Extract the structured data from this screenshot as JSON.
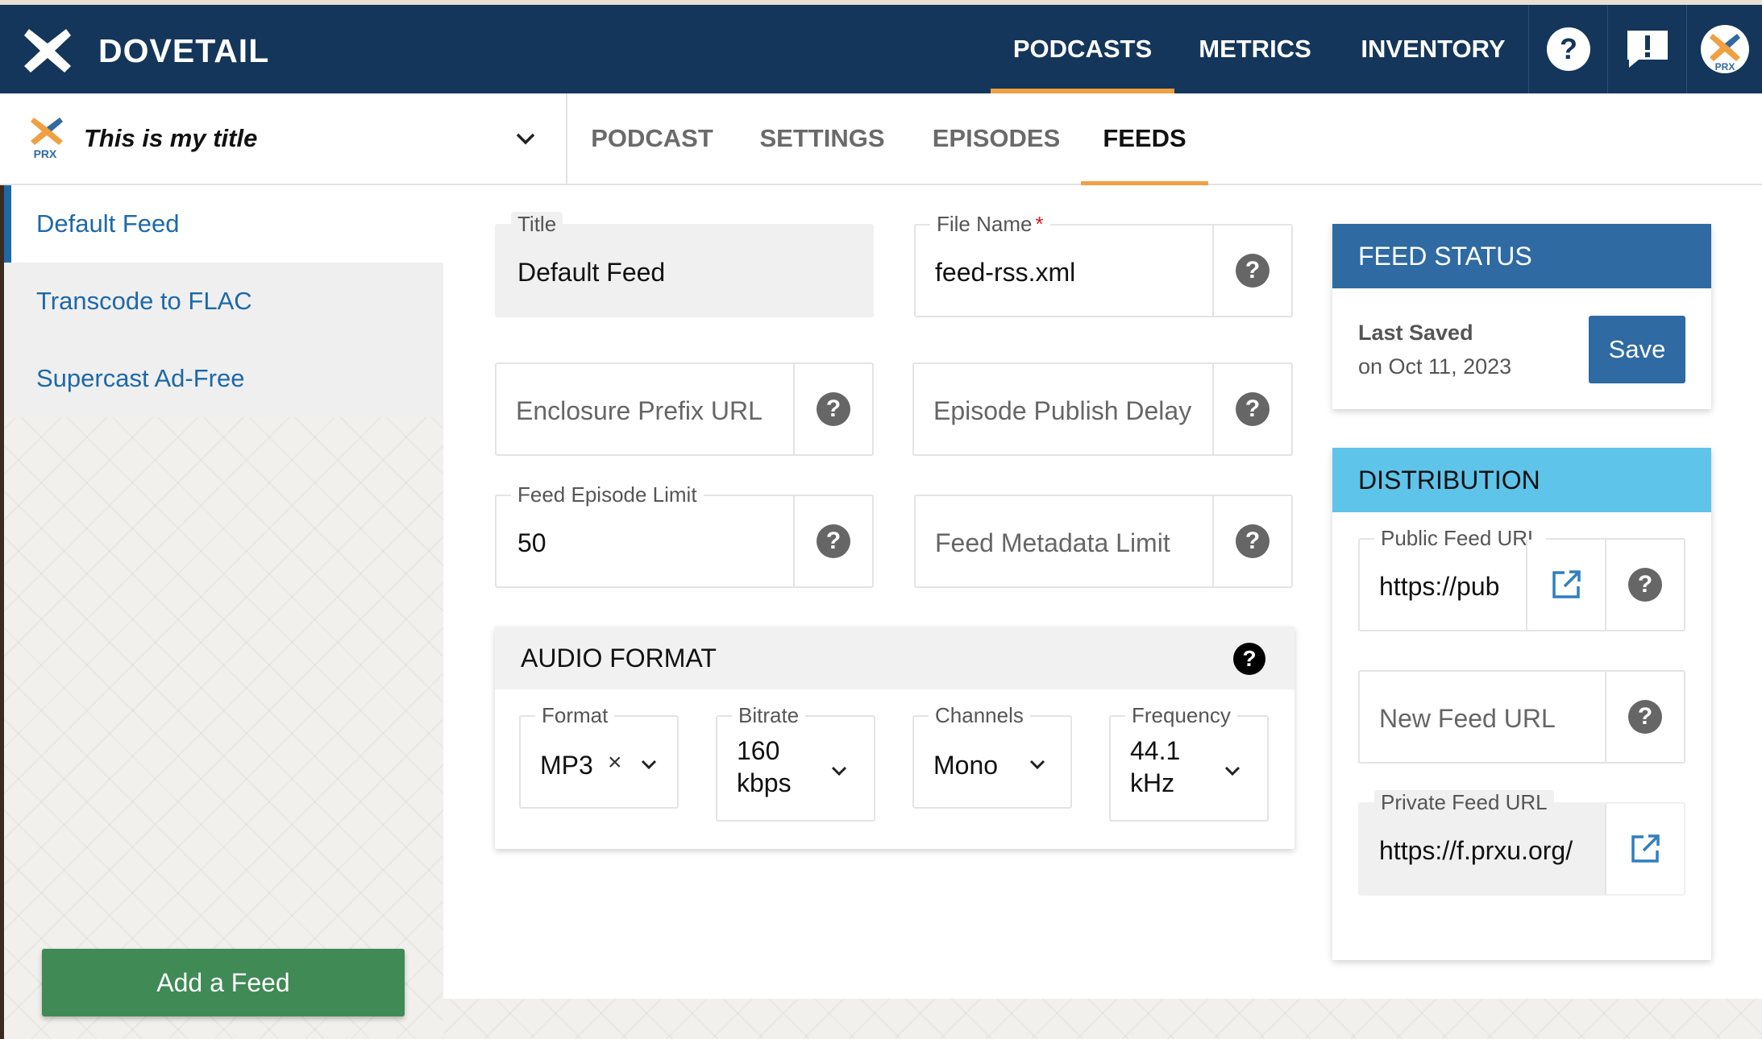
{
  "brand": {
    "name": "DOVETAIL"
  },
  "nav": {
    "links": [
      "PODCASTS",
      "METRICS",
      "INVENTORY"
    ],
    "active": "PODCASTS",
    "help_icon": "question-circle-icon",
    "feedback_icon": "feedback-icon",
    "avatar_label": "PRX"
  },
  "podcast_picker": {
    "title": "This is my title",
    "logo_label": "PRX"
  },
  "sub_tabs": {
    "items": [
      "PODCAST",
      "SETTINGS",
      "EPISODES",
      "FEEDS"
    ],
    "active": "FEEDS"
  },
  "feeds": {
    "items": [
      "Default Feed",
      "Transcode to FLAC",
      "Supercast Ad-Free"
    ],
    "active": "Default Feed",
    "add_label": "Add a Feed"
  },
  "form": {
    "title": {
      "label": "Title",
      "value": "Default Feed"
    },
    "file_name": {
      "label": "File Name",
      "required_mark": "*",
      "value": "feed-rss.xml"
    },
    "enclosure_prefix": {
      "placeholder": "Enclosure Prefix URL"
    },
    "publish_delay": {
      "placeholder": "Episode Publish Delay"
    },
    "episode_limit": {
      "label": "Feed Episode Limit",
      "value": "50"
    },
    "metadata_limit": {
      "placeholder": "Feed Metadata Limit"
    }
  },
  "audio_format": {
    "title": "AUDIO FORMAT",
    "format": {
      "label": "Format",
      "value": "MP3",
      "clear": "×"
    },
    "bitrate": {
      "label": "Bitrate",
      "value_line1": "160",
      "value_line2": "kbps"
    },
    "channels": {
      "label": "Channels",
      "value": "Mono"
    },
    "frequency": {
      "label": "Frequency",
      "value_line1": "44.1",
      "value_line2": "kHz"
    }
  },
  "feed_status": {
    "title": "FEED STATUS",
    "last_saved_label": "Last Saved",
    "last_saved_date": "on Oct 11, 2023",
    "save_label": "Save"
  },
  "distribution": {
    "title": "DISTRIBUTION",
    "public_url": {
      "label": "Public Feed URL",
      "value": "https://pub"
    },
    "new_url": {
      "placeholder": "New Feed URL"
    },
    "private_url": {
      "label": "Private Feed URL",
      "value": "https://f.prxu.org/"
    }
  },
  "colors": {
    "navbar": "#14365a",
    "accent_orange": "#f0a040",
    "link_blue": "#1e68a8",
    "status_header": "#2f6aa2",
    "distribution_header": "#5ec4ea",
    "add_button": "#3f8a55"
  },
  "help_glyph": "?"
}
